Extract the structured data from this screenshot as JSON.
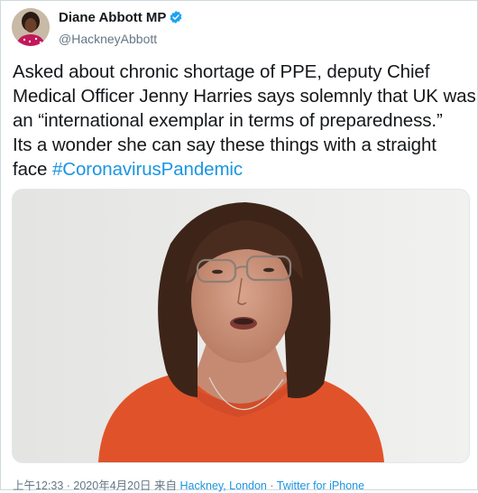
{
  "author": {
    "display_name": "Diane Abbott MP",
    "handle": "@HackneyAbbott",
    "verified": true
  },
  "tweet": {
    "lines": [
      "Asked about chronic shortage of PPE, deputy Chief",
      "Medical Officer Jenny Harries says solemnly that UK was",
      "an “international exemplar in terms of preparedness.”",
      "Its a wonder she can say these things with a straight"
    ],
    "last_line_prefix": "face ",
    "hashtag": "#CoronavirusPandemic"
  },
  "meta": {
    "time_date": "上午12:33 · 2020年4月20日 来自",
    "location": "Hackney, London",
    "separator": "·",
    "source": "Twitter for iPhone"
  },
  "colors": {
    "link": "#1b95e0",
    "verified_badge": "#1da1f2",
    "secondary_text": "#657786"
  },
  "icons": {
    "verified": "verified-badge-icon"
  }
}
